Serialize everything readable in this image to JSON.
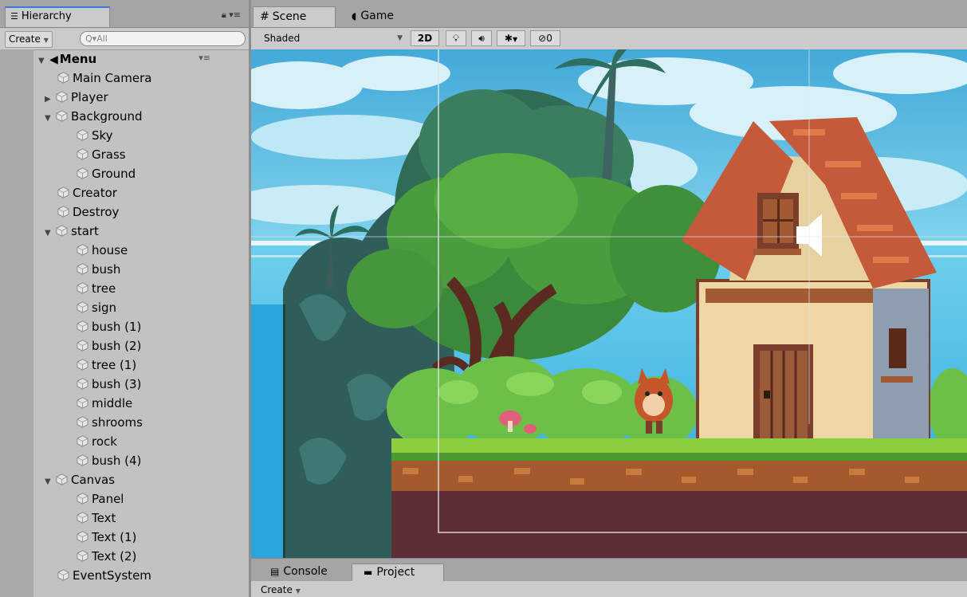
{
  "hierarchy": {
    "tab_label": "Hierarchy",
    "create_label": "Create",
    "search_placeholder": "All",
    "root": "Menu",
    "items": [
      {
        "label": "Main Camera",
        "depth": 1,
        "arrow": ""
      },
      {
        "label": "Player",
        "depth": 1,
        "arrow": "collapsed"
      },
      {
        "label": "Background",
        "depth": 1,
        "arrow": "expanded"
      },
      {
        "label": "Sky",
        "depth": 2,
        "arrow": ""
      },
      {
        "label": "Grass",
        "depth": 2,
        "arrow": ""
      },
      {
        "label": "Ground",
        "depth": 2,
        "arrow": ""
      },
      {
        "label": "Creator",
        "depth": 1,
        "arrow": ""
      },
      {
        "label": "Destroy",
        "depth": 1,
        "arrow": ""
      },
      {
        "label": "start",
        "depth": 1,
        "arrow": "expanded"
      },
      {
        "label": "house",
        "depth": 2,
        "arrow": ""
      },
      {
        "label": "bush",
        "depth": 2,
        "arrow": ""
      },
      {
        "label": "tree",
        "depth": 2,
        "arrow": ""
      },
      {
        "label": "sign",
        "depth": 2,
        "arrow": ""
      },
      {
        "label": "bush (1)",
        "depth": 2,
        "arrow": ""
      },
      {
        "label": "bush (2)",
        "depth": 2,
        "arrow": ""
      },
      {
        "label": "tree (1)",
        "depth": 2,
        "arrow": ""
      },
      {
        "label": "bush (3)",
        "depth": 2,
        "arrow": ""
      },
      {
        "label": "middle",
        "depth": 2,
        "arrow": ""
      },
      {
        "label": "shrooms",
        "depth": 2,
        "arrow": ""
      },
      {
        "label": "rock",
        "depth": 2,
        "arrow": ""
      },
      {
        "label": "bush (4)",
        "depth": 2,
        "arrow": ""
      },
      {
        "label": "Canvas",
        "depth": 1,
        "arrow": "expanded"
      },
      {
        "label": "Panel",
        "depth": 2,
        "arrow": ""
      },
      {
        "label": "Text",
        "depth": 2,
        "arrow": ""
      },
      {
        "label": "Text (1)",
        "depth": 2,
        "arrow": ""
      },
      {
        "label": "Text (2)",
        "depth": 2,
        "arrow": ""
      },
      {
        "label": "EventSystem",
        "depth": 1,
        "arrow": ""
      }
    ]
  },
  "scene": {
    "tabs": [
      {
        "label": "Scene",
        "icon": "grid-icon"
      },
      {
        "label": "Game",
        "icon": "pacman-icon"
      }
    ],
    "shading_mode": "Shaded",
    "mode_2d_label": "2D",
    "hidden_count": "0"
  },
  "bottom": {
    "tabs": [
      {
        "label": "Console",
        "icon": "console-icon"
      },
      {
        "label": "Project",
        "icon": "folder-icon"
      }
    ],
    "create_label": "Create"
  },
  "colors": {
    "panel_bg": "#c2c2c2",
    "tab_accent": "#3b79d8",
    "sky": "#4fb4d9",
    "foliage": "#3f8a35",
    "dirt": "#5e2d36",
    "roof": "#c55a3a"
  }
}
